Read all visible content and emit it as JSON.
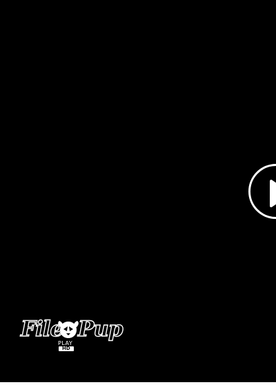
{
  "player": {
    "background": "#000000",
    "play_button": {
      "icon": "play-icon",
      "color": "#ffffff"
    }
  },
  "logo": {
    "word_left": "File",
    "word_right": "Pup",
    "sub_line": "PLAY",
    "badge": "HD",
    "mascot_icon": "dog-head-icon"
  }
}
